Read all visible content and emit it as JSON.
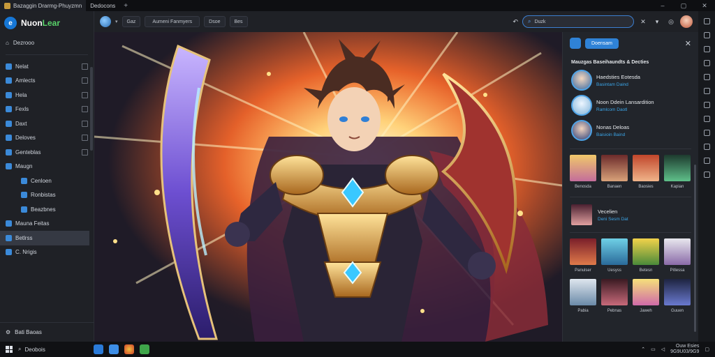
{
  "titlebar": {
    "tabs": [
      {
        "label": "Bazaggin Drarmg-Phuyzmn"
      },
      {
        "label": "Dedocons"
      }
    ],
    "new_tab": "+",
    "window_controls": [
      "–",
      "▢",
      "✕"
    ]
  },
  "sidebar": {
    "brand": {
      "name": "Nuon",
      "accent": "Lear"
    },
    "home_label": "Dezrooo",
    "items": [
      {
        "label": "Nelat",
        "checkbox": true
      },
      {
        "label": "Amlects",
        "checkbox": true
      },
      {
        "label": "Hela",
        "checkbox": true
      },
      {
        "label": "Fexls",
        "checkbox": true
      },
      {
        "label": "Daxt",
        "checkbox": true
      },
      {
        "label": "Deloves",
        "checkbox": true
      },
      {
        "label": "Genteblas",
        "checkbox": true
      }
    ],
    "group_label": "Maugn",
    "sub_items": [
      {
        "label": "Cenloen"
      },
      {
        "label": "Ronbistas"
      },
      {
        "label": "Beazbnes"
      }
    ],
    "extra_items": [
      {
        "label": "Mauna Feitas",
        "selected": false
      },
      {
        "label": "Betlrss",
        "selected": true
      },
      {
        "label": "C. Nrigis",
        "selected": false
      }
    ],
    "bottom_label": "Bati Baoas"
  },
  "toolbar": {
    "tabs": [
      "Gaz",
      "Aumeni Fanmyers",
      "Dsoe",
      "Bes"
    ],
    "search_text": "Duzk",
    "icons": [
      "refresh-icon",
      "search-icon",
      "tools-icon",
      "chevron-down-icon",
      "settings-icon"
    ]
  },
  "hero": {
    "alt": "Anime warrior in golden armor with glowing blade"
  },
  "panel": {
    "header_button": "Doensam",
    "section_title": "Mauzgas Baseihaundts & Decties",
    "recommended": [
      {
        "name": "Haedsties Eotesda",
        "meta": "Basintam Daind"
      },
      {
        "name": "Noon Ddein Lansardition",
        "meta": "Ramlcom Daotl"
      },
      {
        "name": "Nonas Deloas",
        "meta": "Baisioin Baind"
      }
    ],
    "row1": [
      "Benosda",
      "Banaen",
      "Baosies",
      "Kapian"
    ],
    "featured": {
      "name": "Vecelien",
      "meta": "Deni Sesm Dat"
    },
    "row2": [
      "Panulser",
      "Uesyss",
      "Betesn",
      "Pitlessa"
    ],
    "row3": [
      "Pabia",
      "Pebnas",
      "Jaweh",
      "Guuen"
    ]
  },
  "taskbar": {
    "search_label": "Deobois",
    "clock_line1": "Ouw Esies",
    "clock_line2": "9G9U03/9G9"
  },
  "colors": {
    "accent": "#2f82d6",
    "link": "#3ba5e8",
    "brand_green": "#59d36a"
  }
}
